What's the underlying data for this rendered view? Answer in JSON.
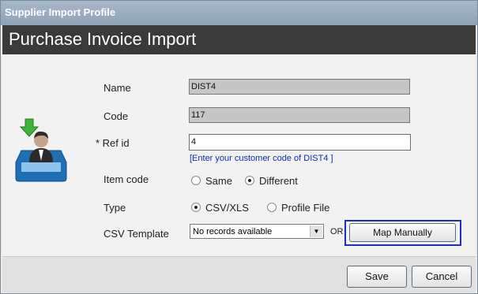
{
  "window": {
    "title": "Supplier Import Profile",
    "header": "Purchase Invoice Import"
  },
  "form": {
    "name_label": "Name",
    "name_value": "DIST4",
    "code_label": "Code",
    "code_value": "117",
    "refid_label": "* Ref id",
    "refid_value": "4",
    "refid_hint": "[Enter your customer code of DIST4 ]",
    "itemcode_label": "Item code",
    "itemcode_options": [
      "Same",
      "Different"
    ],
    "itemcode_selected": "Different",
    "type_label": "Type",
    "type_options": [
      "CSV/XLS",
      "Profile File"
    ],
    "type_selected": "CSV/XLS",
    "csv_template_label": "CSV Template",
    "csv_template_value": "No records available",
    "or_label": "OR",
    "map_manually_label": "Map Manually"
  },
  "footer": {
    "save_label": "Save",
    "cancel_label": "Cancel"
  },
  "icons": {
    "import_profile": "inbox-user-download-icon"
  }
}
